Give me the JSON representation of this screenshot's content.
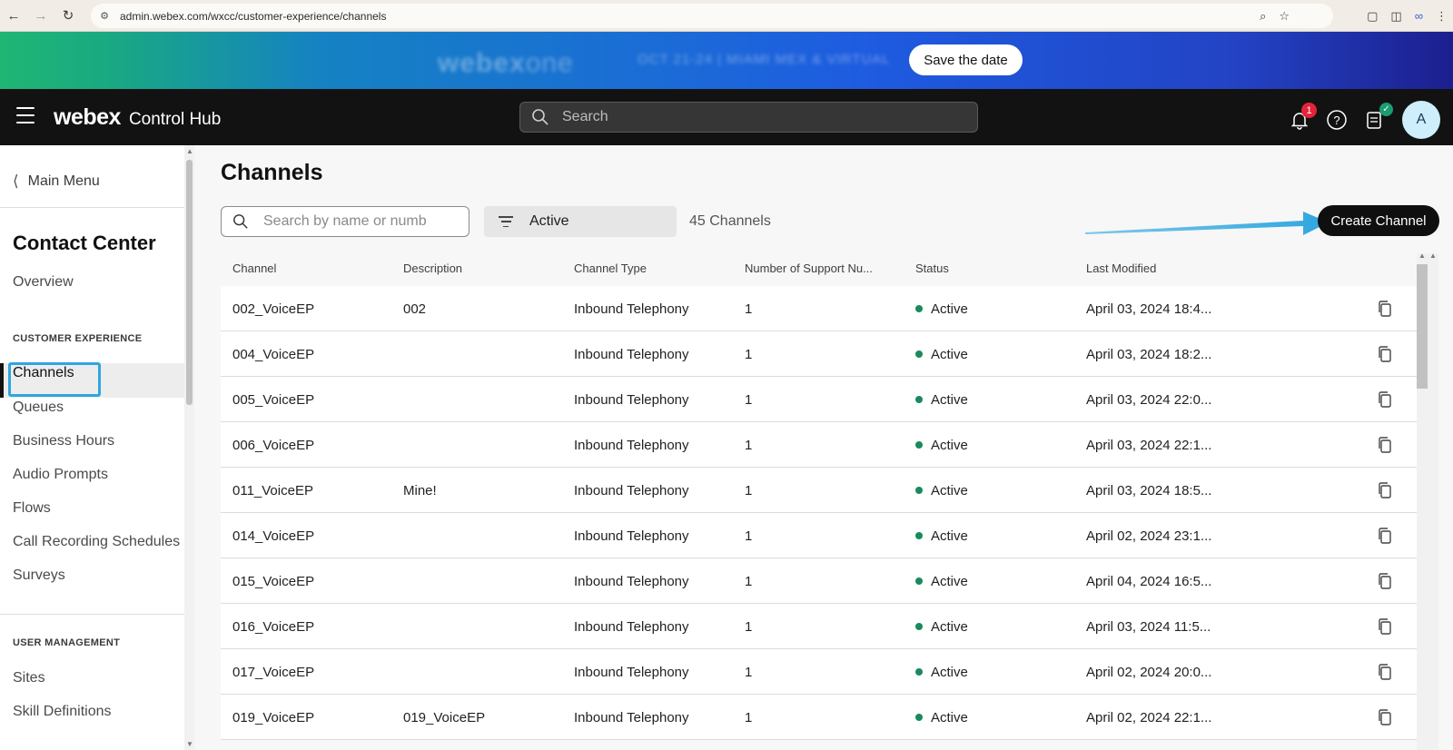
{
  "browser": {
    "url": "admin.webex.com/wxcc/customer-experience/channels"
  },
  "banner": {
    "logo_bold": "webex",
    "logo_light": "one",
    "subtitle": "OCT 21-24 | MIAMI MEX & VIRTUAL",
    "cta_label": "Save the date"
  },
  "header": {
    "brand": "webex",
    "product": "Control Hub",
    "search_placeholder": "Search",
    "notification_count": "1",
    "avatar_initial": "A"
  },
  "sidebar": {
    "back_label": "Main Menu",
    "section_title": "Contact Center",
    "overview_label": "Overview",
    "category_cx": "CUSTOMER EXPERIENCE",
    "cx_items": [
      {
        "label": "Channels"
      },
      {
        "label": "Queues"
      },
      {
        "label": "Business Hours"
      },
      {
        "label": "Audio Prompts"
      },
      {
        "label": "Flows"
      },
      {
        "label": "Call Recording Schedules"
      },
      {
        "label": "Surveys"
      }
    ],
    "category_um": "USER MANAGEMENT",
    "um_items": [
      {
        "label": "Sites"
      },
      {
        "label": "Skill Definitions"
      }
    ],
    "active_item": "Channels"
  },
  "main": {
    "title": "Channels",
    "search_placeholder": "Search by name or number",
    "filter_value": "Active",
    "count_text": "45 Channels",
    "create_label": "Create Channel",
    "accent_color": "#2fa6e0"
  },
  "table": {
    "columns": [
      "Channel",
      "Description",
      "Channel Type",
      "Number of Support Nu...",
      "Status",
      "Last Modified"
    ],
    "rows": [
      {
        "channel": "002_VoiceEP",
        "description": "002",
        "type": "Inbound Telephony",
        "numbers": "1",
        "status": "Active",
        "modified": "April 03, 2024 18:4..."
      },
      {
        "channel": "004_VoiceEP",
        "description": "",
        "type": "Inbound Telephony",
        "numbers": "1",
        "status": "Active",
        "modified": "April 03, 2024 18:2..."
      },
      {
        "channel": "005_VoiceEP",
        "description": "",
        "type": "Inbound Telephony",
        "numbers": "1",
        "status": "Active",
        "modified": "April 03, 2024 22:0..."
      },
      {
        "channel": "006_VoiceEP",
        "description": "",
        "type": "Inbound Telephony",
        "numbers": "1",
        "status": "Active",
        "modified": "April 03, 2024 22:1..."
      },
      {
        "channel": "011_VoiceEP",
        "description": "Mine!",
        "type": "Inbound Telephony",
        "numbers": "1",
        "status": "Active",
        "modified": "April 03, 2024 18:5..."
      },
      {
        "channel": "014_VoiceEP",
        "description": "",
        "type": "Inbound Telephony",
        "numbers": "1",
        "status": "Active",
        "modified": "April 02, 2024 23:1..."
      },
      {
        "channel": "015_VoiceEP",
        "description": "",
        "type": "Inbound Telephony",
        "numbers": "1",
        "status": "Active",
        "modified": "April 04, 2024 16:5..."
      },
      {
        "channel": "016_VoiceEP",
        "description": "",
        "type": "Inbound Telephony",
        "numbers": "1",
        "status": "Active",
        "modified": "April 03, 2024 11:5..."
      },
      {
        "channel": "017_VoiceEP",
        "description": "",
        "type": "Inbound Telephony",
        "numbers": "1",
        "status": "Active",
        "modified": "April 02, 2024 20:0..."
      },
      {
        "channel": "019_VoiceEP",
        "description": "019_VoiceEP",
        "type": "Inbound Telephony",
        "numbers": "1",
        "status": "Active",
        "modified": "April 02, 2024 22:1..."
      }
    ],
    "status_color": "#1a8a5c"
  }
}
